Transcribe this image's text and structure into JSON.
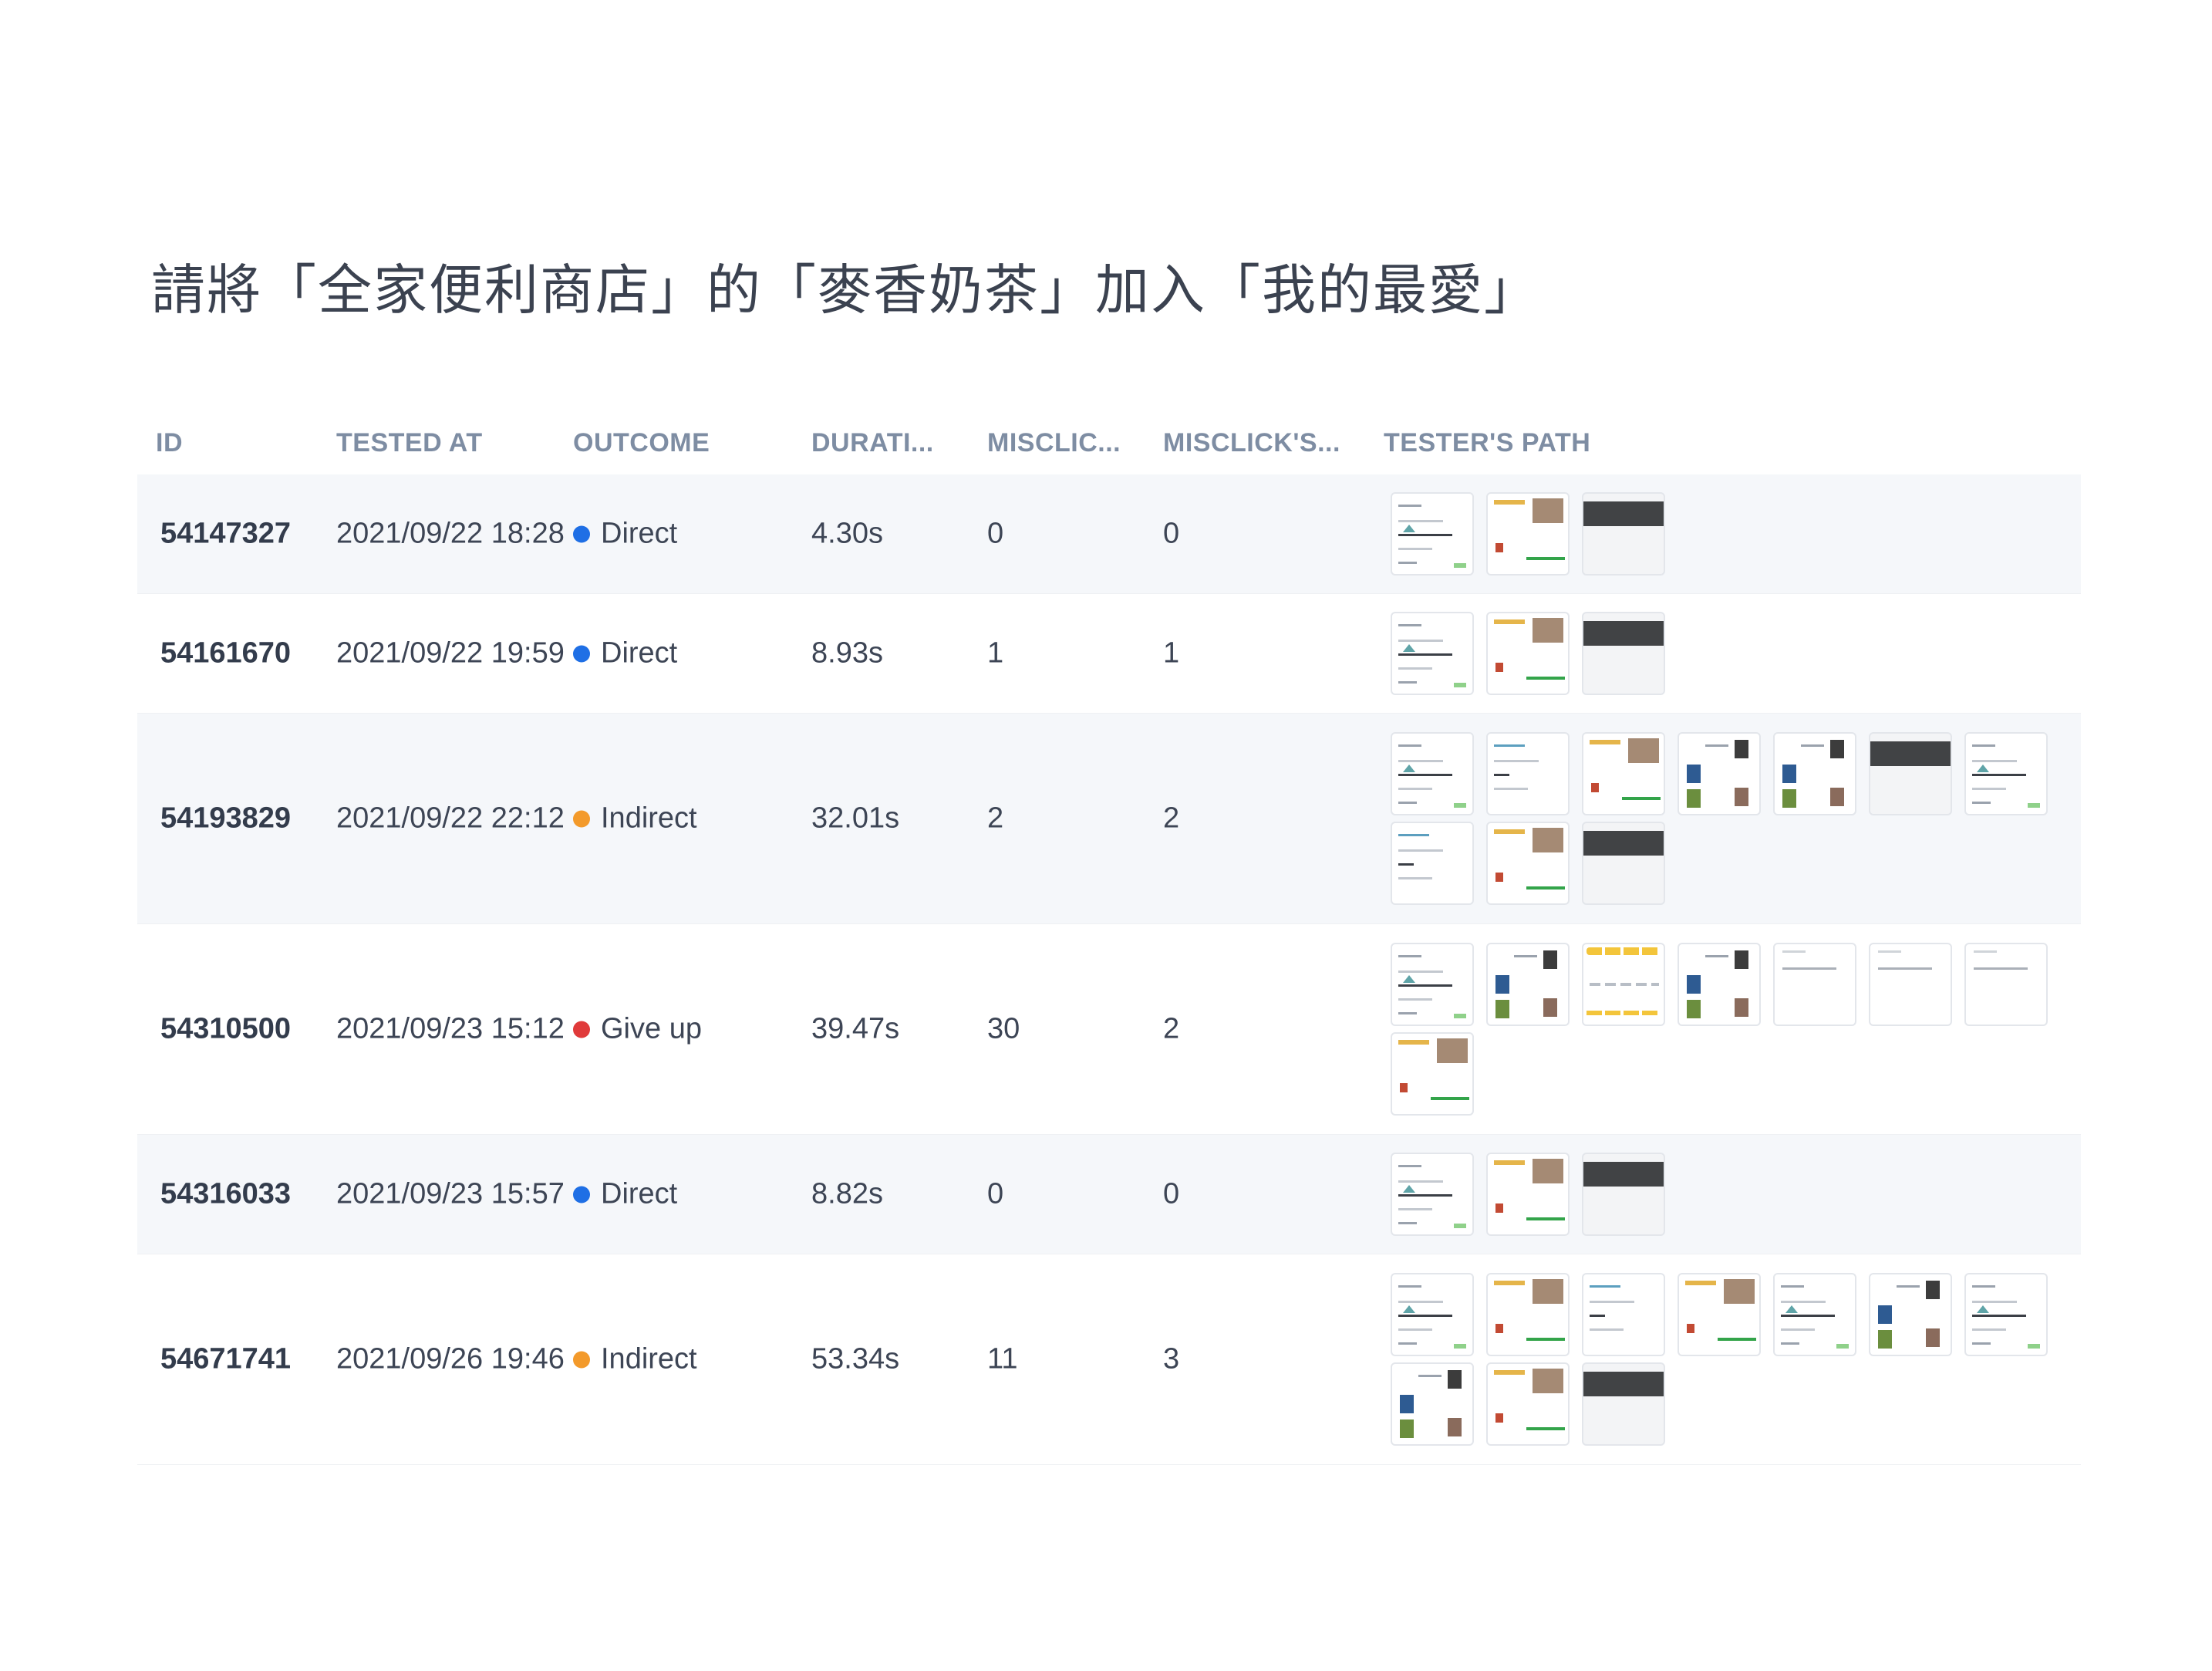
{
  "task_title": "請將「全家便利商店」的「麥香奶茶」加入「我的最愛」",
  "columns": {
    "id": "ID",
    "tested_at": "TESTED AT",
    "outcome": "OUTCOME",
    "duration": "DURATI...",
    "misclicks": "MISCLIC...",
    "misclick_screens": "MISCLICK'S...",
    "path": "TESTER'S PATH"
  },
  "outcome_colors": {
    "Direct": "#1f6fe5",
    "Indirect": "#f39a2b",
    "Give up": "#e03a3a"
  },
  "rows": [
    {
      "id": "54147327",
      "tested_at": "2021/09/22 18:28",
      "outcome": "Direct",
      "duration": "4.30s",
      "misclicks": "0",
      "misclick_screens": "0",
      "path": [
        "home",
        "product",
        "dark"
      ]
    },
    {
      "id": "54161670",
      "tested_at": "2021/09/22 19:59",
      "outcome": "Direct",
      "duration": "8.93s",
      "misclicks": "1",
      "misclick_screens": "1",
      "path": [
        "home",
        "product",
        "dark"
      ]
    },
    {
      "id": "54193829",
      "tested_at": "2021/09/22 22:12",
      "outcome": "Indirect",
      "duration": "32.01s",
      "misclicks": "2",
      "misclick_screens": "2",
      "path": [
        "home",
        "list",
        "product",
        "products",
        "products",
        "dark",
        "home",
        "list",
        "product",
        "dark"
      ]
    },
    {
      "id": "54310500",
      "tested_at": "2021/09/23 15:12",
      "outcome": "Give up",
      "duration": "39.47s",
      "misclicks": "30",
      "misclick_screens": "2",
      "path": [
        "home",
        "products",
        "yellow",
        "products",
        "blank",
        "blank",
        "blank",
        "product"
      ]
    },
    {
      "id": "54316033",
      "tested_at": "2021/09/23 15:57",
      "outcome": "Direct",
      "duration": "8.82s",
      "misclicks": "0",
      "misclick_screens": "0",
      "path": [
        "home",
        "product",
        "dark"
      ]
    },
    {
      "id": "54671741",
      "tested_at": "2021/09/26 19:46",
      "outcome": "Indirect",
      "duration": "53.34s",
      "misclicks": "11",
      "misclick_screens": "3",
      "path": [
        "home",
        "product",
        "list",
        "product",
        "home",
        "products",
        "home",
        "products",
        "product",
        "dark"
      ]
    }
  ]
}
